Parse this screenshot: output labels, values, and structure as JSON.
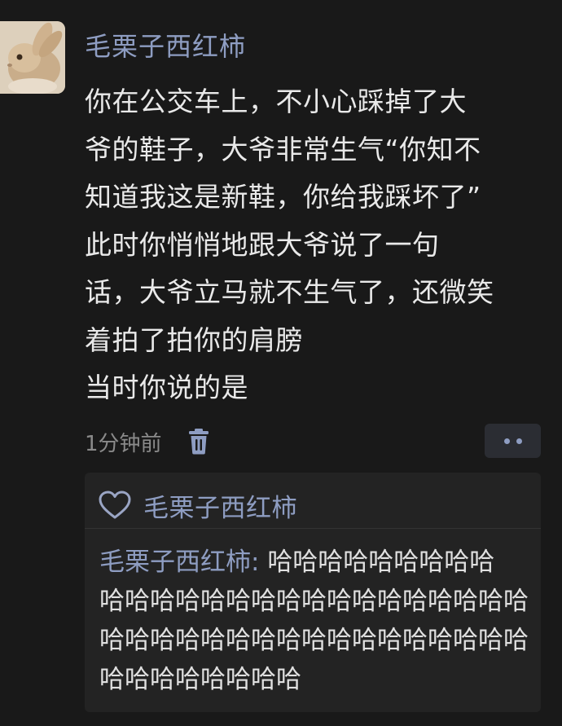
{
  "comment": {
    "username": "毛栗子西红柿",
    "lines": [
      "你在公交车上，不小心踩掉了大",
      "爷的鞋子，大爷非常生气“你知不",
      "知道我这是新鞋，你给我踩坏了”",
      "此时你悄悄地跟大爷说了一句",
      "话，大爷立马就不生气了，还微笑",
      "着拍了拍你的肩膀",
      "当时你说的是"
    ],
    "time": "1分钟前",
    "avatar_icon": "rabbit-avatar",
    "delete_icon": "trash-icon",
    "more_icon": "more-dots-icon"
  },
  "replies": {
    "like_icon": "heart-icon",
    "liker": "毛栗子西红柿",
    "reply_author": "毛栗子西红柿",
    "reply_sep": ":",
    "reply_lines": [
      "哈哈哈哈哈哈哈哈哈",
      "哈哈哈哈哈哈哈哈哈哈哈哈哈哈哈哈哈",
      "哈哈哈哈哈哈哈哈哈哈哈哈哈哈哈哈哈",
      "哈哈哈哈哈哈哈哈"
    ]
  },
  "colors": {
    "background": "#191919",
    "username": "#8e9dc2",
    "text": "#e9e9e9",
    "muted": "#8a8a8a",
    "reply_box": "#232323"
  }
}
